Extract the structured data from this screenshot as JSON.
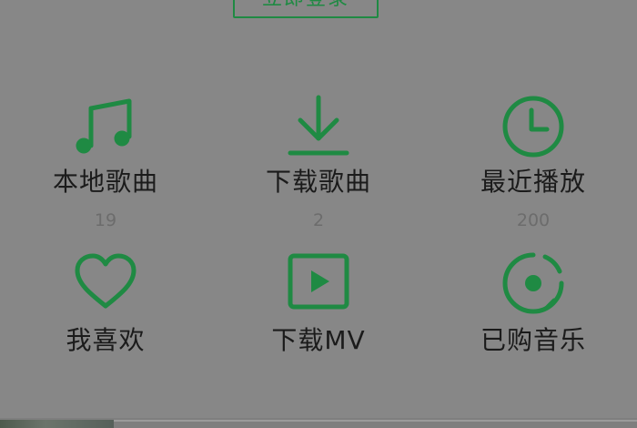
{
  "header": {
    "login_label": "立即登录"
  },
  "colors": {
    "accent": "#1f8a43",
    "background": "#878787",
    "label": "#1b1b1b",
    "count": "#6c6c6c"
  },
  "grid": {
    "items": [
      {
        "label": "本地歌曲",
        "count": "19",
        "icon": "music-note-icon"
      },
      {
        "label": "下载歌曲",
        "count": "2",
        "icon": "download-icon"
      },
      {
        "label": "最近播放",
        "count": "200",
        "icon": "clock-icon"
      },
      {
        "label": "我喜欢",
        "icon": "heart-icon"
      },
      {
        "label": "下载MV",
        "icon": "video-play-icon"
      },
      {
        "label": "已购音乐",
        "icon": "purchased-disc-icon"
      }
    ]
  }
}
